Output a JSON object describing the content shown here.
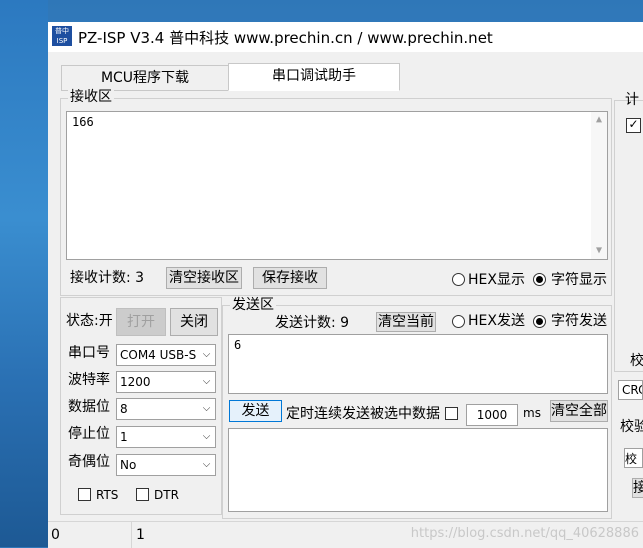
{
  "window": {
    "title": "PZ-ISP V3.4 普中科技  www.prechin.cn / www.prechin.net",
    "icon_lines": [
      "普中",
      "ISP"
    ]
  },
  "tabs": [
    {
      "label": "MCU程序下载",
      "active": false
    },
    {
      "label": "串口调试助手",
      "active": true
    }
  ],
  "receive": {
    "group_label": "接收区",
    "content": "166",
    "count_label": "接收计数: 3",
    "clear_button": "清空接收区",
    "save_button": "保存接收",
    "hex_label": "HEX显示",
    "char_label": "字符显示",
    "mode": "char"
  },
  "serial": {
    "status_label": "状态:开",
    "open_button": "打开",
    "close_button": "关闭",
    "port_label": "串口号",
    "port_value": "COM4  USB-S",
    "baud_label": "波特率",
    "baud_value": "1200",
    "databits_label": "数据位",
    "databits_value": "8",
    "stopbits_label": "停止位",
    "stopbits_value": "1",
    "parity_label": "奇偶位",
    "parity_value": "No",
    "rts_label": "RTS",
    "dtr_label": "DTR"
  },
  "send": {
    "group_label": "发送区",
    "count_label": "发送计数: 9",
    "clear_current_button": "清空当前",
    "hex_label": "HEX发送",
    "char_label": "字符发送",
    "mode": "char",
    "content": "6",
    "send_button": "发送",
    "timer_label": "定时连续发送被选中数据",
    "interval_value": "1000",
    "interval_unit": "ms",
    "clear_all_button": "清空全部"
  },
  "right": {
    "top_label": "计",
    "check_label": "校",
    "crc_label": "CRC",
    "verify_label": "校验",
    "verify_box": "校验",
    "btn_label": "接"
  },
  "statusbar": {
    "cell1": "0",
    "cell2": "1",
    "watermark": "https://blog.csdn.net/qq_40628886"
  }
}
